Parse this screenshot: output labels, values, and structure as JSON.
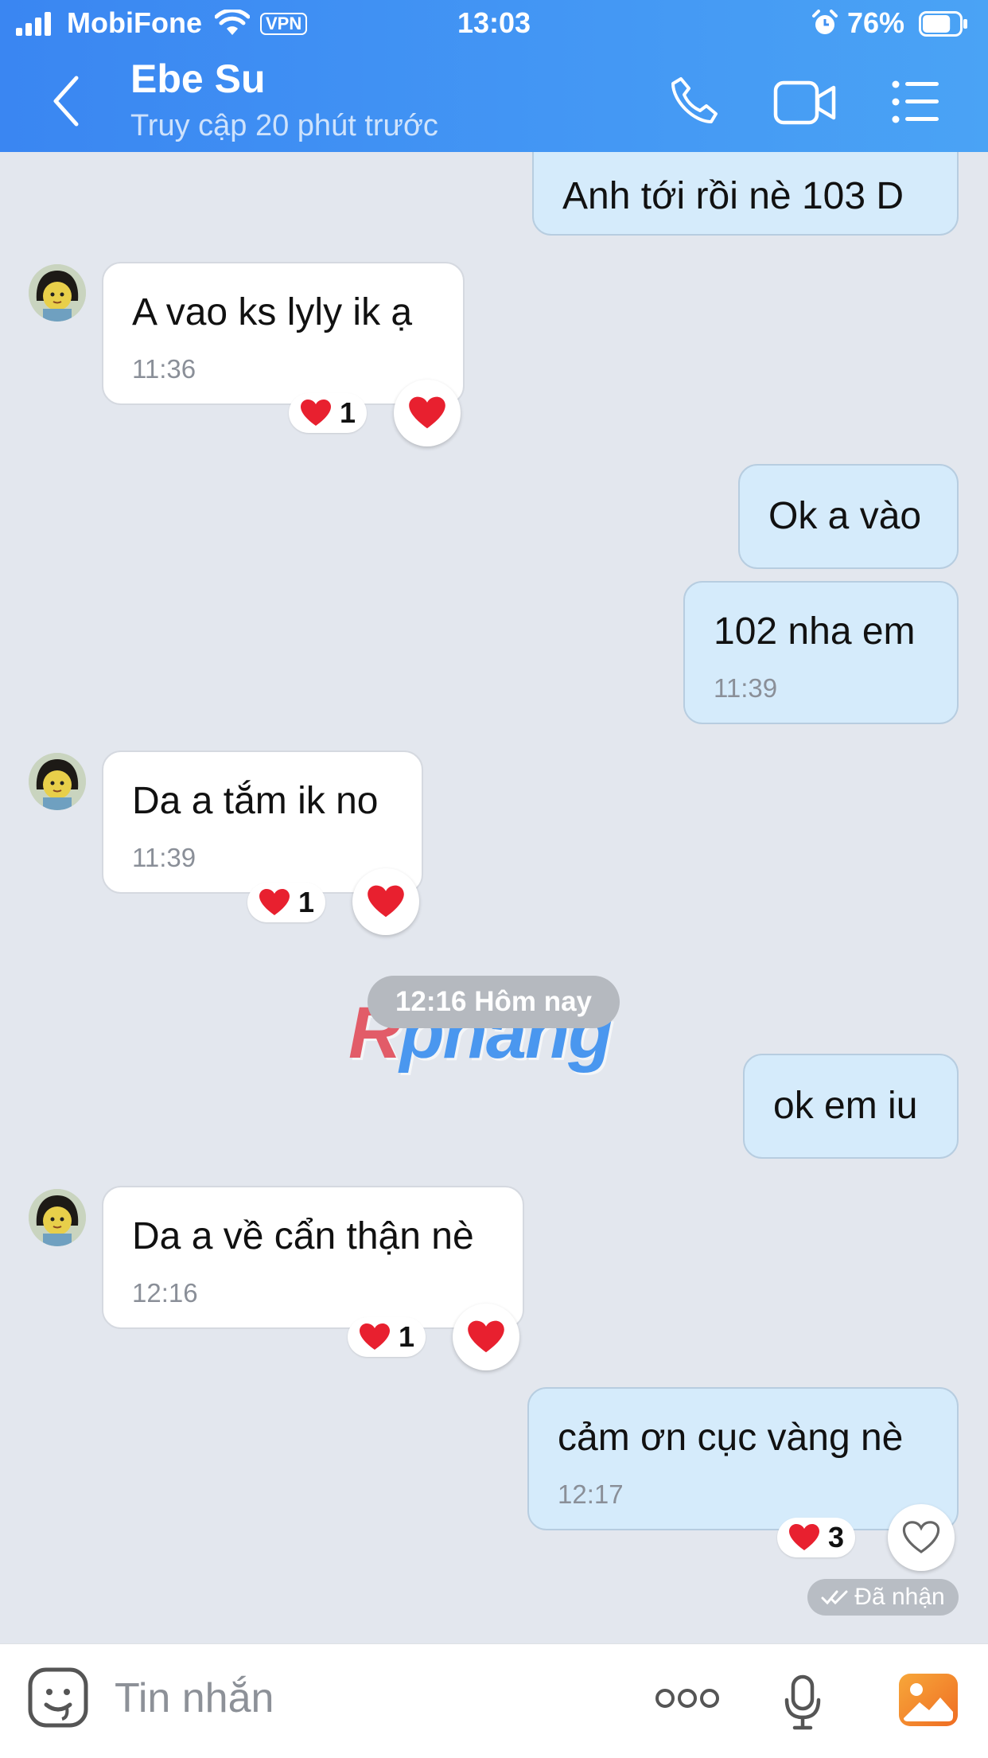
{
  "status_bar": {
    "carrier": "MobiFone",
    "vpn": "VPN",
    "time": "13:03",
    "battery": "76%",
    "battery_level": 0.76
  },
  "header": {
    "name": "Ebe Su",
    "status": "Truy cập 20 phút trước",
    "icons": [
      "back-icon",
      "phone-icon",
      "video-camera-icon",
      "menu-list-icon"
    ]
  },
  "messages": [
    {
      "dir": "out",
      "text": "Anh tới rồi nè 103 D"
    },
    {
      "dir": "in",
      "text": "A vao ks lyly ik ạ",
      "time": "11:36",
      "reaction_count": "1"
    },
    {
      "dir": "out",
      "text": "Ok a vào"
    },
    {
      "dir": "out",
      "text": "102 nha em",
      "time": "11:39"
    },
    {
      "dir": "in",
      "text": "Da a tắm ik no",
      "time": "11:39",
      "reaction_count": "1"
    },
    {
      "dir": "out",
      "text": "ok em iu"
    },
    {
      "dir": "in",
      "text": "Da a về cẩn thận nè",
      "time": "12:16",
      "reaction_count": "1"
    },
    {
      "dir": "out",
      "text": "cảm ơn cục vàng nè",
      "time": "12:17",
      "reaction_count": "3"
    }
  ],
  "divider": "12:16 Hôm nay",
  "delivery_status": "Đã nhận",
  "watermark": {
    "first": "R",
    "rest": "phang"
  },
  "composer": {
    "placeholder": "Tin nhắn",
    "icons": [
      "sticker-icon",
      "more-icon",
      "microphone-icon",
      "gallery-icon"
    ]
  },
  "colors": {
    "header_start": "#3a86f2",
    "header_end": "#4aa3f5",
    "chat_bg": "#e3e7ee",
    "out_bubble": "#d5ebfb",
    "in_bubble": "#ffffff",
    "heart": "#e8202f",
    "gallery_orange": "#f38b2a"
  }
}
